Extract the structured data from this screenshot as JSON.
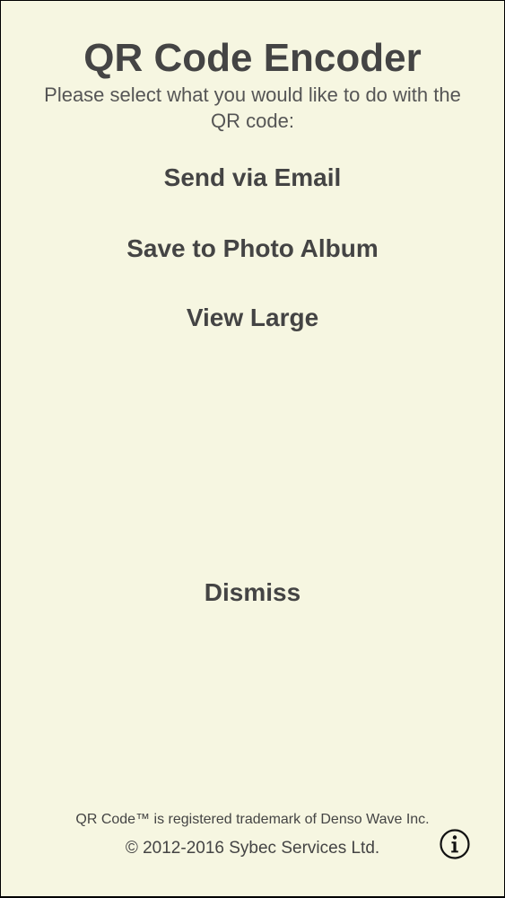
{
  "app": {
    "title": "QR Code Encoder",
    "subtitle": "Please select what you would like to do with the QR code:"
  },
  "actions": {
    "send_email": "Send via Email",
    "save_photo": "Save to Photo Album",
    "view_large": "View Large",
    "dismiss": "Dismiss"
  },
  "footer": {
    "trademark": "QR Code™ is registered trademark of Denso Wave Inc.",
    "copyright": "© 2012-2016 Sybec Services Ltd."
  },
  "icons": {
    "info": "info-icon"
  },
  "colors": {
    "background": "#f6f6e1",
    "text": "#444444"
  }
}
